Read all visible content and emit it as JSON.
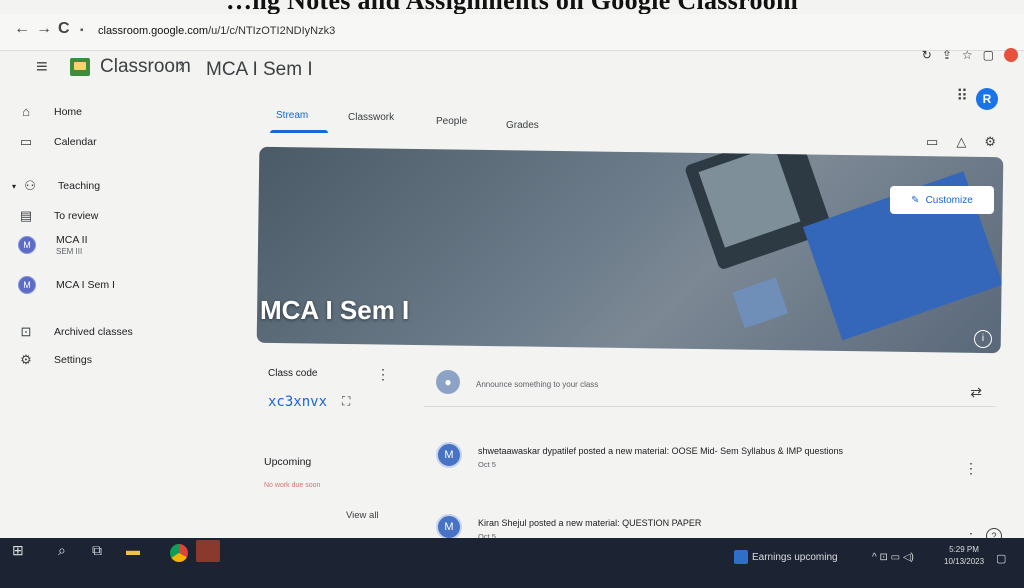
{
  "caption": "…ng Notes and Assignments on Google Classroom",
  "browser": {
    "back": "←",
    "forward": "→",
    "reload": "C",
    "url_host": "classroom.google.com",
    "url_path": "/u/1/c/NTIzOTI2NDIyNzk3",
    "icons": [
      "↻",
      "⇪",
      "☆",
      "▢"
    ]
  },
  "header": {
    "app_name": "Classroom",
    "separator": "›",
    "class_name": "MCA I Sem I",
    "avatar_letter": "R"
  },
  "sidebar": {
    "items": [
      {
        "label": "Home",
        "icon": "home-icon"
      },
      {
        "label": "Calendar",
        "icon": "calendar-icon"
      },
      {
        "label": "Teaching",
        "icon": "people-icon"
      },
      {
        "label": "To review",
        "icon": "review-icon"
      },
      {
        "label": "MCA II",
        "sub": "SEM III",
        "letter": "M"
      },
      {
        "label": "MCA I Sem I",
        "letter": "M"
      },
      {
        "label": "Archived classes",
        "icon": "archive-icon"
      },
      {
        "label": "Settings",
        "icon": "gear-icon"
      }
    ]
  },
  "tabs": [
    "Stream",
    "Classwork",
    "People",
    "Grades"
  ],
  "banner": {
    "title": "MCA I Sem I",
    "customize_label": "Customize"
  },
  "class_code": {
    "label": "Class code",
    "code": "xc3xnvx"
  },
  "upcoming": {
    "label": "Upcoming",
    "note": "No work due soon",
    "view_all": "View all"
  },
  "announce": {
    "placeholder": "Announce something to your class"
  },
  "posts": [
    {
      "text": "shwetaawaskar dypatilef posted a new material: OOSE Mid- Sem Syllabus & IMP questions",
      "date": "Oct 5",
      "avatar": "M"
    },
    {
      "text": "Kiran Shejul posted a new material: QUESTION PAPER",
      "date": "Oct 5",
      "avatar": "M"
    }
  ],
  "taskbar": {
    "widget": "Earnings upcoming",
    "time": "5:29 PM",
    "date": "10/13/2023"
  }
}
